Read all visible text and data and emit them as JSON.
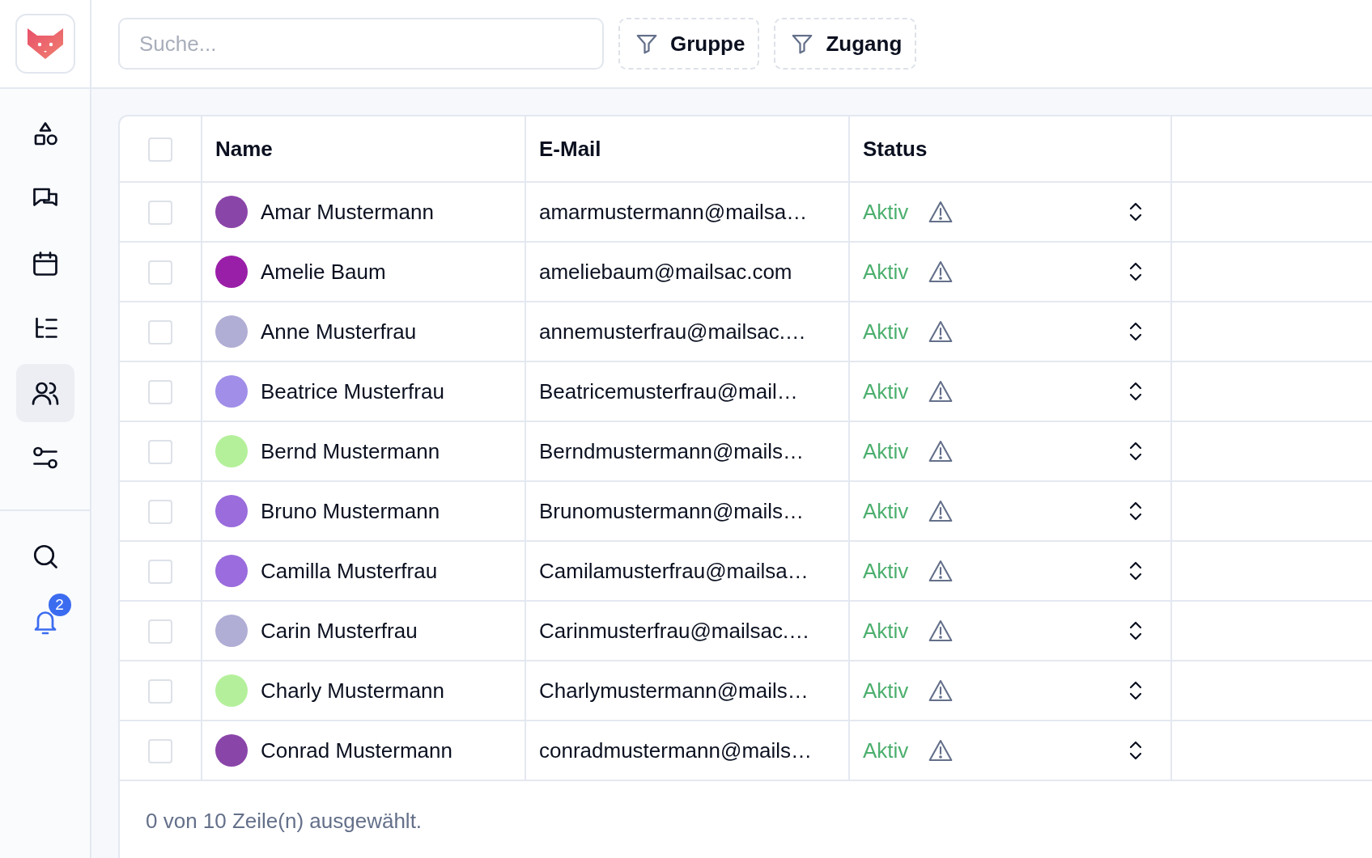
{
  "sidebar": {
    "nav": [
      {
        "selected": false
      },
      {
        "selected": false
      },
      {
        "selected": false
      },
      {
        "selected": false
      },
      {
        "selected": true
      },
      {
        "selected": false
      }
    ],
    "notification_badge": "2"
  },
  "search": {
    "placeholder": "Suche..."
  },
  "filters": [
    "Gruppe",
    "Zugang"
  ],
  "table": {
    "columns": [
      "Name",
      "E-Mail",
      "Status"
    ],
    "header_checked": false,
    "rows": [
      {
        "checked": false,
        "color": "#8a45a8",
        "name": "Amar Mustermann",
        "email": "amarmustermann@mailsa…",
        "status": "Aktiv"
      },
      {
        "checked": false,
        "color": "#9a1fa8",
        "name": "Amelie Baum",
        "email": "ameliebaum@mailsac.com",
        "status": "Aktiv"
      },
      {
        "checked": false,
        "color": "#b0aed4",
        "name": "Anne Musterfrau",
        "email": "annemusterfrau@mailsac.…",
        "status": "Aktiv"
      },
      {
        "checked": false,
        "color": "#a08ee8",
        "name": "Beatrice Musterfrau",
        "email": "Beatricemusterfrau@mail…",
        "status": "Aktiv"
      },
      {
        "checked": false,
        "color": "#b4f09a",
        "name": "Bernd Mustermann",
        "email": "Berndmustermann@mails…",
        "status": "Aktiv"
      },
      {
        "checked": false,
        "color": "#9a6cdc",
        "name": "Bruno Mustermann",
        "email": "Brunomustermann@mails…",
        "status": "Aktiv"
      },
      {
        "checked": false,
        "color": "#9a6cdd",
        "name": "Camilla Musterfrau",
        "email": "Camilamusterfrau@mailsa…",
        "status": "Aktiv"
      },
      {
        "checked": false,
        "color": "#b0aed5",
        "name": "Carin Musterfrau",
        "email": "Carinmusterfrau@mailsac.…",
        "status": "Aktiv"
      },
      {
        "checked": false,
        "color": "#b4f09b",
        "name": "Charly Mustermann",
        "email": "Charlymustermann@mails…",
        "status": "Aktiv"
      },
      {
        "checked": false,
        "color": "#8a45a9",
        "name": "Conrad Mustermann",
        "email": "conradmustermann@mails…",
        "status": "Aktiv"
      }
    ],
    "footer": "0 von 10 Zeile(n) ausgewählt."
  }
}
